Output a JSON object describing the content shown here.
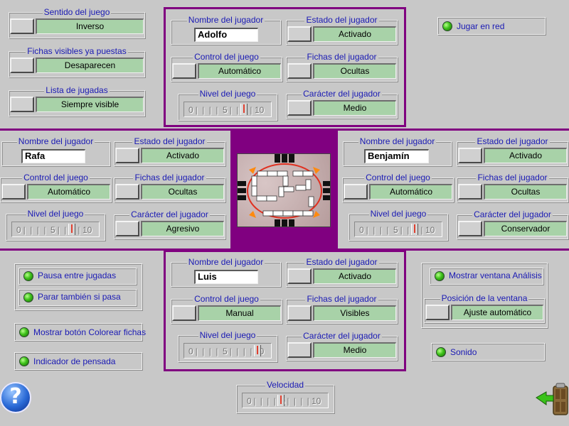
{
  "general": {
    "sentido": {
      "legend": "Sentido del juego",
      "value": "Inverso"
    },
    "fichas_visibles": {
      "legend": "Fichas visibles ya puestas",
      "value": "Desaparecen"
    },
    "lista_jugadas": {
      "legend": "Lista de jugadas",
      "value": "Siempre visible"
    },
    "jugar_red": "Jugar en red"
  },
  "labels": {
    "nombre": "Nombre del jugador",
    "estado": "Estado del jugador",
    "control": "Control del juego",
    "fichas": "Fichas del jugador",
    "nivel": "Nivel del juego",
    "caracter": "Carácter del jugador"
  },
  "ticks": [
    "0",
    "5",
    "10"
  ],
  "players": {
    "top": {
      "name": "Adolfo",
      "estado": "Activado",
      "control": "Automático",
      "fichas": "Ocultas",
      "nivel": 8,
      "caracter": "Medio"
    },
    "left": {
      "name": "Rafa",
      "estado": "Activado",
      "control": "Automático",
      "fichas": "Ocultas",
      "nivel": 8,
      "caracter": "Agresivo"
    },
    "right": {
      "name": "Benjamín",
      "estado": "Activado",
      "control": "Automático",
      "fichas": "Ocultas",
      "nivel": 8,
      "caracter": "Conservador"
    },
    "bottom": {
      "name": "Luis",
      "estado": "Activado",
      "control": "Manual",
      "fichas": "Visibles",
      "nivel": 10,
      "caracter": "Medio"
    }
  },
  "toggles": {
    "pausa": "Pausa entre jugadas",
    "parar": "Parar también si pasa",
    "colorear": "Mostrar botón Colorear fichas",
    "pensada": "Indicador de pensada",
    "analisis": "Mostrar ventana Análisis",
    "posicion_legend": "Posición de la ventana",
    "posicion_value": "Ajuste automático",
    "sonido": "Sonido"
  },
  "velocidad": {
    "legend": "Velocidad",
    "value": 5
  },
  "icons": {
    "help": "?",
    "exit": "exit-door-icon"
  },
  "colors": {
    "accent_purple": "#800080",
    "value_green": "#a8d2a8",
    "legend_blue": "#1a1ab4",
    "led_green": "#3ec21a"
  }
}
